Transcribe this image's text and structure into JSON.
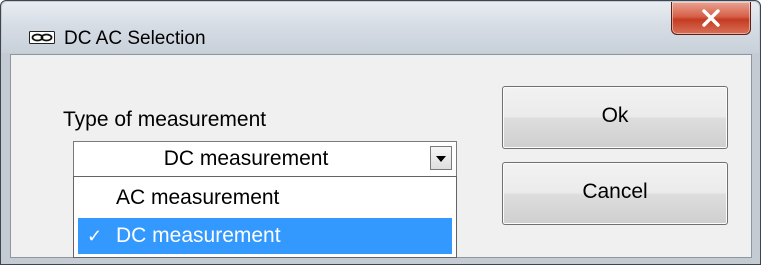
{
  "window": {
    "title": "DC AC Selection",
    "title_icon": "link-chain-icon",
    "close_icon": "close-x-icon"
  },
  "form": {
    "type_label": "Type of measurement",
    "combo": {
      "selected_value": "DC measurement",
      "arrow_icon": "dropdown-arrow-icon",
      "options": [
        {
          "label": "AC measurement",
          "selected": false
        },
        {
          "label": "DC measurement",
          "selected": true,
          "check_mark": "✓"
        }
      ]
    }
  },
  "buttons": {
    "ok_label": "Ok",
    "cancel_label": "Cancel"
  },
  "colors": {
    "selection_highlight": "#3399ff",
    "close_button_red": "#c43c22",
    "client_background": "#f0f0f0"
  }
}
